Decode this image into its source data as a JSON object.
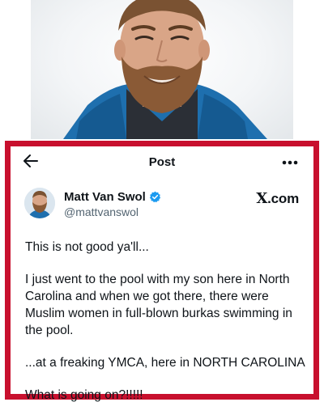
{
  "header": {
    "title": "Post",
    "back_icon": "arrow-left-icon",
    "more_icon": "ellipsis-icon"
  },
  "post": {
    "author": {
      "display_name": "Matt Van Swol",
      "handle": "@mattvanswol",
      "verified": true,
      "verified_color": "#1d9bf0"
    },
    "brand": ".com",
    "brand_mark": "X",
    "paragraphs": [
      "This is not good ya'll...",
      "I just went to the pool with my son here in North Carolina and when we got there, there were Muslim women in full-blown burkas swimming in the pool.",
      "...at a freaking YMCA, here in NORTH CAROLINA",
      "What is going on?!!!!!"
    ]
  },
  "colors": {
    "frame": "#c8102e",
    "text": "#0f1419",
    "secondary_text": "#536471"
  }
}
